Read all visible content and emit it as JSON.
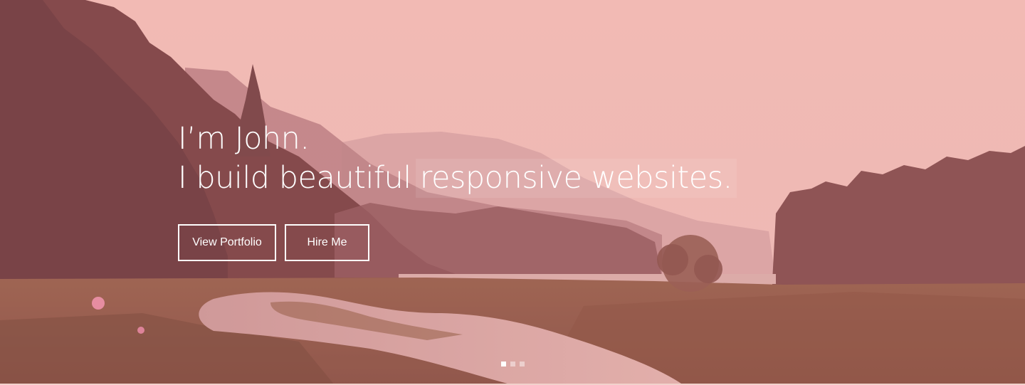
{
  "hero": {
    "headline_line1": "I’m John.",
    "headline_line2_static": "I build beautiful",
    "headline_line2_typed": "responsive websites.",
    "buttons": {
      "portfolio_label": "View Portfolio",
      "hire_label": "Hire Me"
    },
    "carousel": {
      "slide_count": 3,
      "active_index": 0
    },
    "colors": {
      "text": "#ffffff",
      "sky": "#f2c3bd",
      "forest": "#7a4a45",
      "field": "#8a5a40"
    }
  }
}
